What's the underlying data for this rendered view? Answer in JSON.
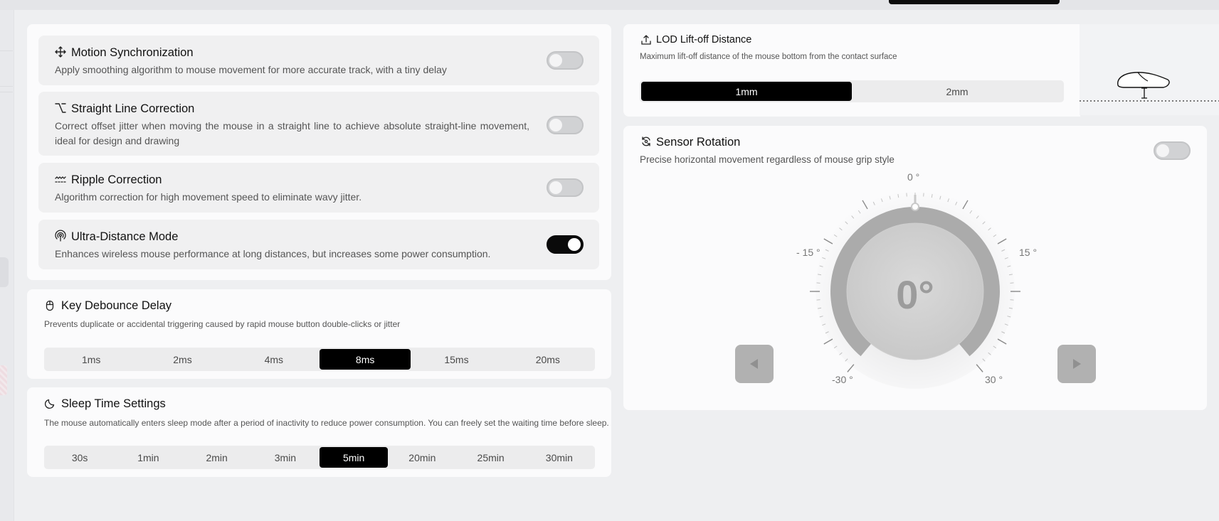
{
  "features": [
    {
      "icon": "move-arrows-icon",
      "title": "Motion Synchronization",
      "desc": "Apply smoothing algorithm to mouse movement for more accurate track, with a tiny delay",
      "enabled": false
    },
    {
      "icon": "straight-line-icon",
      "title": "Straight Line Correction",
      "desc": "Correct offset jitter when moving the mouse in a straight line to achieve absolute straight-line movement, ideal for design and drawing",
      "enabled": false
    },
    {
      "icon": "ripple-icon",
      "title": "Ripple Correction",
      "desc": "Algorithm correction for high movement speed to eliminate wavy jitter.",
      "enabled": false
    },
    {
      "icon": "antenna-signal-icon",
      "title": "Ultra-Distance Mode",
      "desc": "Enhances wireless mouse performance at long distances, but increases some power consumption.",
      "enabled": true
    }
  ],
  "debounce": {
    "icon": "mouse-icon",
    "title": "Key Debounce Delay",
    "desc": "Prevents duplicate or accidental triggering caused by rapid mouse button double-clicks or jitter",
    "options": [
      "1ms",
      "2ms",
      "4ms",
      "8ms",
      "15ms",
      "20ms"
    ],
    "selected": 3
  },
  "sleep": {
    "icon": "moon-icon",
    "title": "Sleep Time Settings",
    "desc": "The mouse automatically enters sleep mode after a period of inactivity to reduce power consumption. You can freely set the waiting time before sleep.",
    "options": [
      "30s",
      "1min",
      "2min",
      "3min",
      "5min",
      "20min",
      "25min",
      "30min"
    ],
    "selected": 4
  },
  "lod": {
    "icon": "lift-off-icon",
    "title": "LOD Lift-off Distance",
    "desc": "Maximum lift-off distance of the mouse bottom from the contact surface",
    "options": [
      "1mm",
      "2mm"
    ],
    "selected": 0
  },
  "sensor": {
    "icon": "rotation-icon",
    "title": "Sensor Rotation",
    "desc": "Precise horizontal movement regardless of mouse grip style",
    "enabled": false,
    "value_text": "0°",
    "angle": 0,
    "labels": {
      "top": "0 °",
      "left_mid": "- 15 °",
      "right_mid": "15 °",
      "left_low": "-30 °",
      "right_low": "30 °"
    }
  },
  "colors": {
    "accent": "#000000",
    "toggle_off": "#d1d2d4",
    "dial": "#a9a9a9"
  }
}
